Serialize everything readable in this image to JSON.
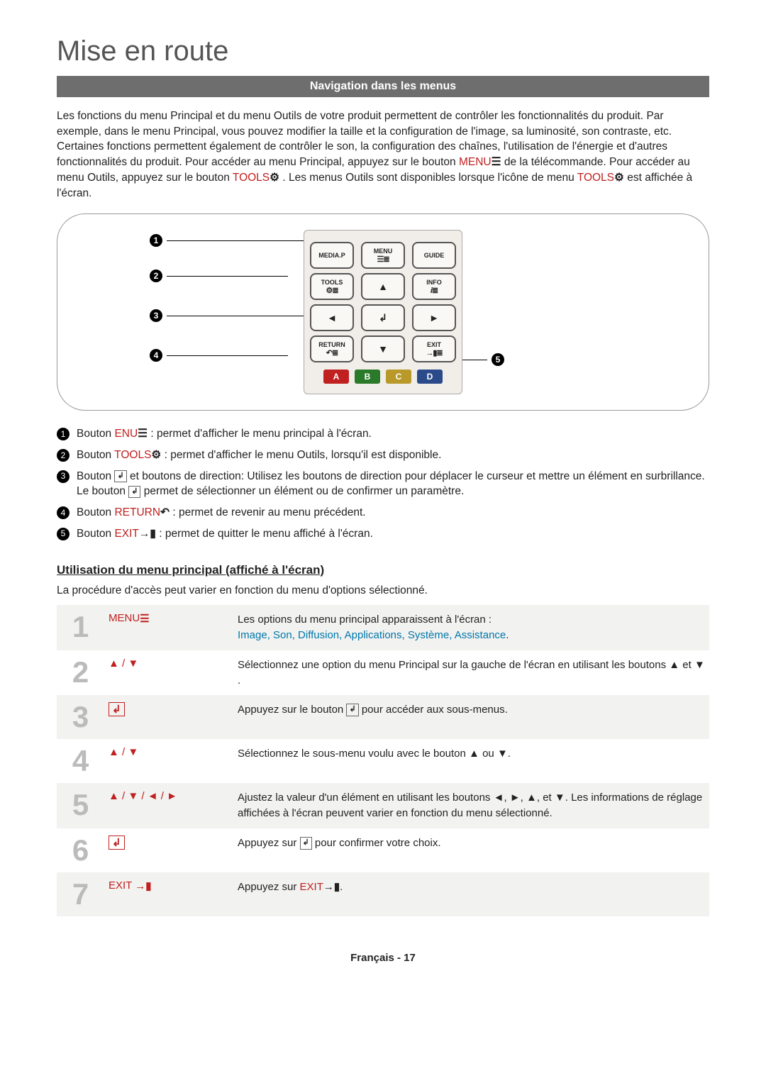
{
  "title": "Mise en route",
  "section_header": "Navigation dans les menus",
  "intro": {
    "part1": "Les fonctions du menu Principal et du menu Outils de votre produit permettent de contrôler les fonctionnalités du produit. Par exemple, dans le menu Principal, vous pouvez modifier la taille et la configuration de l'image, sa luminosité, son contraste, etc. Certaines fonctions permettent également de contrôler le son, la configuration des chaînes, l'utilisation de l'énergie et d'autres fonctionnalités du produit. Pour accéder au menu Principal, appuyez sur le bouton ",
    "menu": "MENU",
    "part2": " de la télécommande. Pour accéder au menu Outils, appuyez sur le bouton ",
    "tools1": "TOOLS",
    "part3": ". Les menus Outils sont disponibles lorsque l'icône de menu ",
    "tools2": "TOOLS",
    "part4": " est affichée à l'écran."
  },
  "remote_callouts": [
    "1",
    "2",
    "3",
    "4",
    "5"
  ],
  "remote": {
    "mediap": "MEDIA.P",
    "menu": "MENU",
    "guide": "GUIDE",
    "tools": "TOOLS",
    "info": "INFO",
    "return": "RETURN",
    "exit": "EXIT",
    "A": "A",
    "B": "B",
    "C": "C",
    "D": "D"
  },
  "legend": [
    {
      "num": "1",
      "prefix": "Bouton ",
      "red": "ENU",
      "glyph": "m",
      "text": " : permet d'afficher le menu principal à l'écran."
    },
    {
      "num": "2",
      "prefix": "Bouton ",
      "red": "TOOLS",
      "glyph": "T",
      "text": " : permet d'afficher le menu Outils, lorsqu'il est disponible."
    },
    {
      "num": "3",
      "prefix": "Bouton ",
      "red": "",
      "glyph": "E",
      "text": " et boutons de direction: Utilisez les boutons de direction pour déplacer le curseur et mettre un élément en surbrillance. Le bouton E permet de sélectionner un élément ou de confirmer un paramètre."
    },
    {
      "num": "4",
      "prefix": "Bouton ",
      "red": "RETURN",
      "glyph": "R",
      "text": " : permet de revenir au menu précédent."
    },
    {
      "num": "5",
      "prefix": "Bouton ",
      "red": "EXIT",
      "glyph": "e",
      "text": " : permet de quitter le menu affiché à l'écran."
    }
  ],
  "subsection_title": "Utilisation du menu principal (affiché à l'écran)",
  "subsection_intro": "La procédure d'accès peut varier en fonction du menu d'options sélectionné.",
  "steps": [
    {
      "n": "1",
      "action": "MENUm",
      "desc_plain": "Les options du menu principal apparaissent à l'écran :",
      "desc_blue": "Image, Son, Diffusion, Applications, Système, Assistance",
      "desc_trail": "."
    },
    {
      "n": "2",
      "action": "▲ / ▼",
      "desc_plain": "Sélectionnez une option du menu Principal sur la gauche de l'écran en utilisant les boutons ▲ et ▼."
    },
    {
      "n": "3",
      "action": "E",
      "desc_plain": "Appuyez sur le bouton E pour accéder aux sous-menus."
    },
    {
      "n": "4",
      "action": "▲ / ▼",
      "desc_plain": "Sélectionnez le sous-menu voulu avec le bouton ▲ ou ▼."
    },
    {
      "n": "5",
      "action": "▲ / ▼ / ◄ / ►",
      "desc_plain": "Ajustez la valeur d'un élément en utilisant les boutons ◄, ►, ▲, et ▼. Les informations de réglage affichées à l'écran peuvent varier en fonction du menu sélectionné."
    },
    {
      "n": "6",
      "action": "E",
      "desc_plain": "Appuyez sur E pour confirmer votre choix."
    },
    {
      "n": "7",
      "action": "EXIT →e",
      "desc_prefix": "Appuyez sur ",
      "desc_red": "EXIT",
      "desc_trail": "→e."
    }
  ],
  "footer": "Français - 17"
}
